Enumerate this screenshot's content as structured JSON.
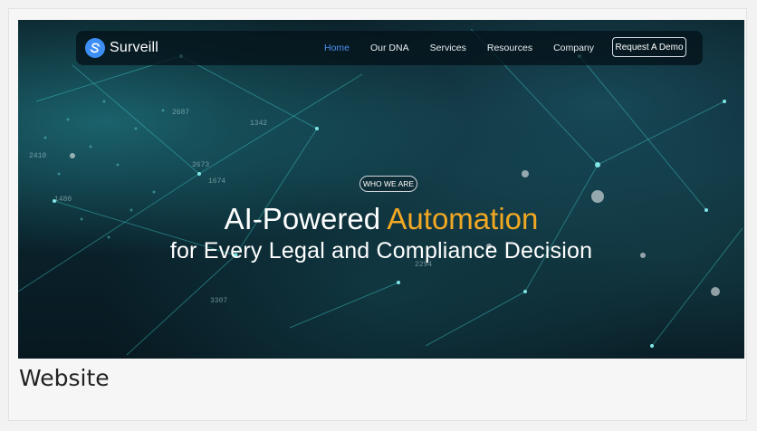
{
  "header": {
    "logo_text": "Surveill",
    "nav": [
      {
        "label": "Home",
        "active": true
      },
      {
        "label": "Our DNA",
        "active": false
      },
      {
        "label": "Services",
        "active": false
      },
      {
        "label": "Resources",
        "active": false
      },
      {
        "label": "Company",
        "active": false
      }
    ],
    "cta_label": "Request A Demo"
  },
  "hero": {
    "pill_label": "WHO WE ARE",
    "headline_plain": "AI-Powered",
    "headline_accent": "Automation",
    "subheadline": "for Every Legal and Compliance Decision",
    "background_numbers": [
      "2410",
      "1480",
      "2673",
      "1674",
      "2294",
      "3307",
      "2687",
      "1342"
    ]
  },
  "caption": "Website",
  "colors": {
    "accent": "#f2a823",
    "brand": "#3d8ef5",
    "active_link": "#4a90f0",
    "hero_bg": "#0b2630"
  },
  "icons": {
    "logo": "surveill-logo-icon"
  }
}
